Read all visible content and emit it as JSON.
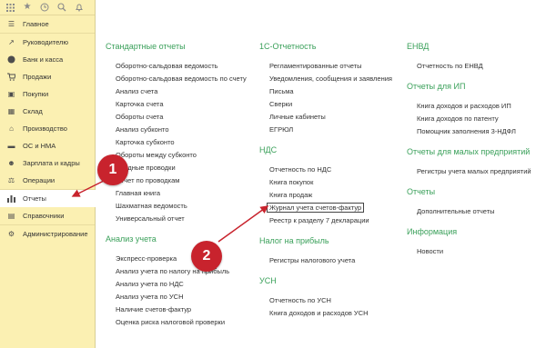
{
  "sidebar": {
    "topbar_icons": [
      "apps-grid-icon",
      "star-icon",
      "history-icon",
      "search-icon",
      "bell-icon"
    ],
    "items": [
      {
        "label": "Главное",
        "icon": "menu-icon"
      },
      {
        "label": "Руководителю",
        "icon": "chart-up-icon"
      },
      {
        "label": "Банк и касса",
        "icon": "coin-icon"
      },
      {
        "label": "Продажи",
        "icon": "cart-icon"
      },
      {
        "label": "Покупки",
        "icon": "basket-icon"
      },
      {
        "label": "Склад",
        "icon": "warehouse-icon"
      },
      {
        "label": "Производство",
        "icon": "factory-icon"
      },
      {
        "label": "ОС и НМА",
        "icon": "truck-icon"
      },
      {
        "label": "Зарплата и кадры",
        "icon": "people-icon"
      },
      {
        "label": "Операции",
        "icon": "scale-icon"
      },
      {
        "label": "Отчеты",
        "icon": "bar-chart-icon",
        "active": true
      },
      {
        "label": "Справочники",
        "icon": "book-icon"
      },
      {
        "label": "Администрирование",
        "icon": "gear-icon"
      }
    ]
  },
  "col1": {
    "sections": [
      {
        "title": "Стандартные отчеты",
        "links": [
          "Оборотно-сальдовая ведомость",
          "Оборотно-сальдовая ведомость по счету",
          "Анализ счета",
          "Карточка счета",
          "Обороты счета",
          "Анализ субконто",
          "Карточка субконто",
          "Обороты между субконто",
          "Сводные проводки",
          "Отчет по проводкам",
          "Главная книга",
          "Шахматная ведомость",
          "Универсальный отчет"
        ]
      },
      {
        "title": "Анализ учета",
        "links": [
          "Экспресс-проверка",
          "Анализ учета по налогу на прибыль",
          "Анализ учета по НДС",
          "Анализ учета по УСН",
          "Наличие счетов-фактур",
          "Оценка риска налоговой проверки"
        ]
      }
    ]
  },
  "col2": {
    "sections": [
      {
        "title": "1С-Отчетность",
        "links": [
          "Регламентированные отчеты",
          "Уведомления, сообщения и заявления",
          "Письма",
          "Сверки",
          "Личные кабинеты",
          "ЕГРЮЛ"
        ]
      },
      {
        "title": "НДС",
        "links": [
          "Отчетность по НДС",
          "Книга покупок",
          "Книга продаж",
          "Журнал учета счетов-фактур",
          "Реестр к разделу 7 декларации"
        ]
      },
      {
        "title": "Налог на прибыль",
        "links": [
          "Регистры налогового учета"
        ]
      },
      {
        "title": "УСН",
        "links": [
          "Отчетность по УСН",
          "Книга доходов и расходов УСН"
        ]
      }
    ]
  },
  "col3": {
    "sections": [
      {
        "title": "ЕНВД",
        "links": [
          "Отчетность по ЕНВД"
        ]
      },
      {
        "title": "Отчеты для ИП",
        "links": [
          "Книга доходов и расходов ИП",
          "Книга доходов по патенту",
          "Помощник заполнения 3-НДФЛ"
        ]
      },
      {
        "title": "Отчеты для малых предприятий",
        "links": [
          "Регистры учета малых предприятий"
        ]
      },
      {
        "title": "Отчеты",
        "links": [
          "Дополнительные отчеты"
        ]
      },
      {
        "title": "Информация",
        "links": [
          "Новости"
        ]
      }
    ]
  },
  "annotations": {
    "badge1": "1",
    "badge2": "2",
    "accent_color": "#c8232d"
  },
  "colors": {
    "sidebar_bg": "#fbf0b2",
    "section_title": "#3aa05a"
  }
}
